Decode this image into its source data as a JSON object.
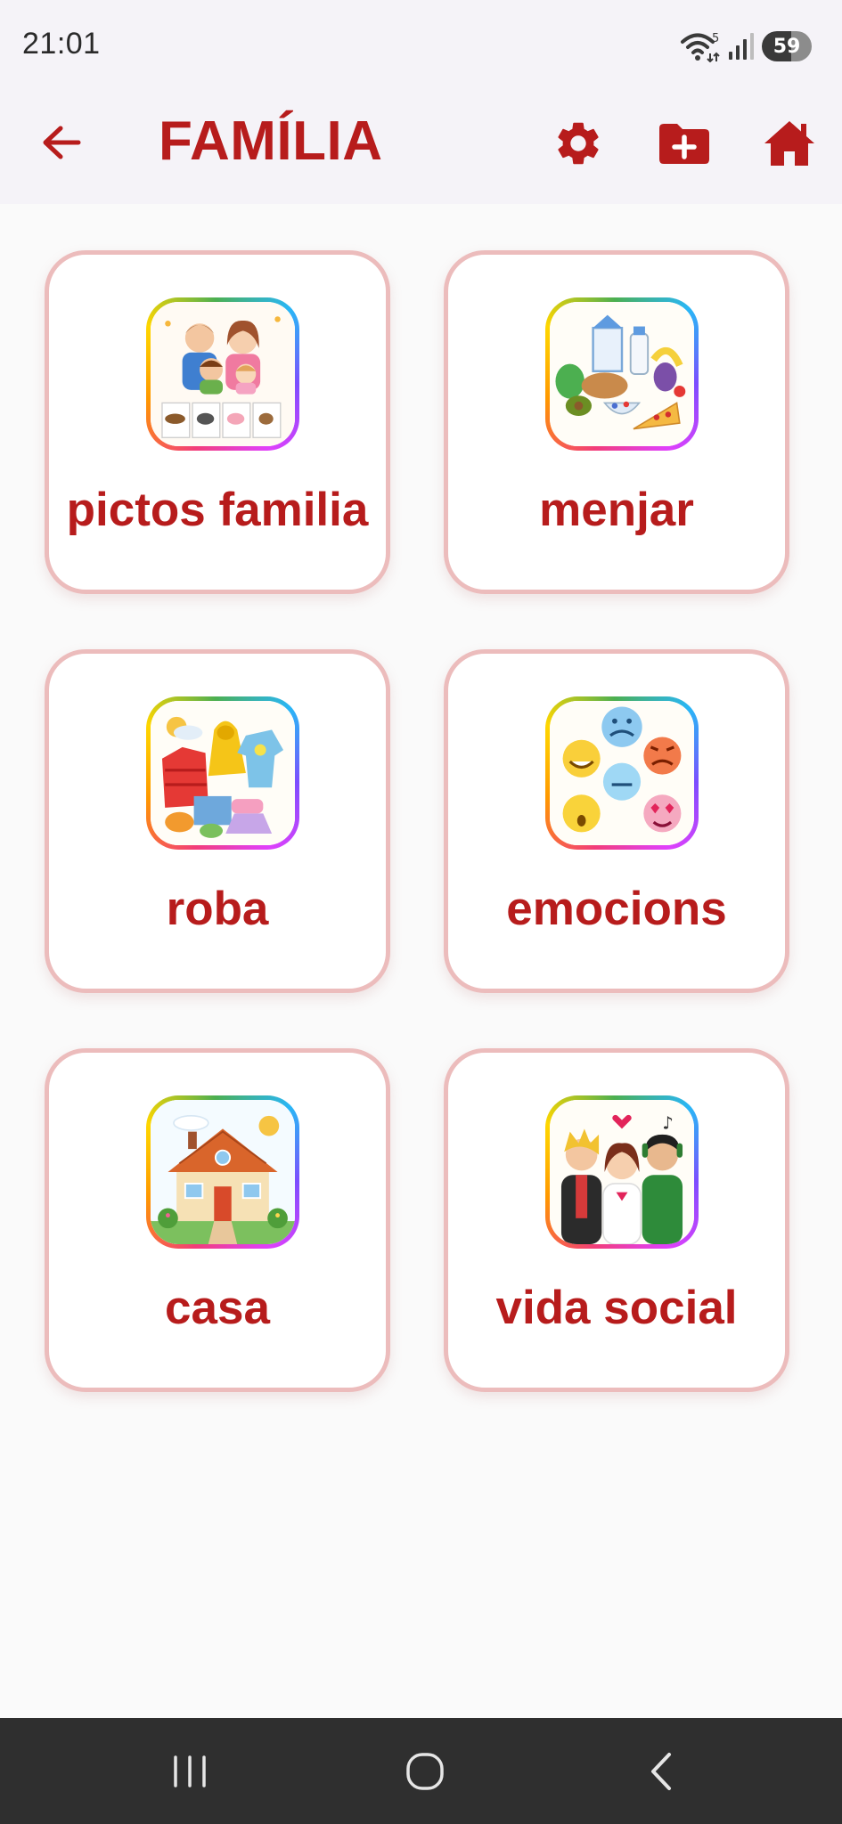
{
  "status_bar": {
    "time": "21:01",
    "wifi_badge": "5",
    "battery_percent": 59,
    "battery_label": "59",
    "icons": [
      "wifi-icon",
      "signal-icon",
      "battery-icon"
    ]
  },
  "app_bar": {
    "title": "FAMÍLIA",
    "actions": [
      "back-arrow-icon",
      "gear-icon",
      "folder-plus-icon",
      "home-icon"
    ]
  },
  "categories": [
    {
      "label": "pictos familia",
      "image": "family-picture"
    },
    {
      "label": "menjar",
      "image": "food-picture"
    },
    {
      "label": "roba",
      "image": "clothes-picture"
    },
    {
      "label": "emocions",
      "image": "emotions-picture"
    },
    {
      "label": "casa",
      "image": "house-picture"
    },
    {
      "label": "vida social",
      "image": "social-life-picture"
    }
  ],
  "nav_bar": {
    "buttons": [
      "recents-icon",
      "home-circle-icon",
      "back-chevron-icon"
    ]
  },
  "colors": {
    "accent": "#b71c1c",
    "card_border": "#ecbcbc",
    "app_bar_background": "#f5f3f8",
    "page_background": "#fafafa",
    "nav_bar_background": "#2f2f2f"
  }
}
